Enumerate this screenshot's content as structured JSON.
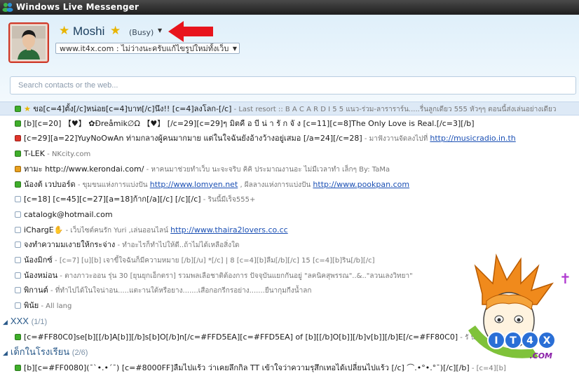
{
  "window": {
    "title": "Windows Live Messenger"
  },
  "profile": {
    "display_name": "Moshi",
    "status": "(Busy)",
    "personal_message": "www.it4x.com : ไม่ว่างนะครับแก้ไขรูปใหม่ทั้งเว็บ"
  },
  "search": {
    "placeholder": "Search contacts or the web..."
  },
  "contacts": [
    {
      "status": "online",
      "star": true,
      "nick": "ขอ[c=4]ตั้ง[/c]หน่อย[c=4]บาท[/c]นึง!!   [c=4]ลงโลก-[/c]",
      "psm": " - Last resort  ::  B A C A R D I    5    5       แนว-ร่วม-ลาราราร์น.....รื่นลูกเดียว   555  หัวๆๆ         ตอนนี้ส่งเล่นอย่างเดียว",
      "link": ""
    },
    {
      "status": "online",
      "nick": "[b][c=20] 【♥】 ✿Đreåmik∅Ω 【♥】 [/c=29][c=29]ๆ มิตคื อ บี น่ า รั ก จั ง [c=11][c=8]The Only Love is Real.[/c=3][/b]",
      "psm": "",
      "link": ""
    },
    {
      "status": "busy",
      "nick": "[c=29][a=22]YuyNoOwAn ท่ามกลางผู้คนมากมาย  แต่ในใจฉันยังอ้างว้างอยู่เสมอ [/a=24][/c=28]",
      "psm": " - มาฟังวานจัดลงไปที่ ",
      "link": "http://musicradio.in.th"
    },
    {
      "status": "online",
      "nick": "T-LEK",
      "psm": " - NKcity.com",
      "link": ""
    },
    {
      "status": "away",
      "nick": "ทามะ http://www.kerondai.com/",
      "psm": " - หาคนมาช่วยทำเว็บ นะจะจริบ คิคิ ประมาณงานอะ ไม่มีเวลาทำ เล็กๆ By: TaMa",
      "link": ""
    },
    {
      "status": "online",
      "nick": "น้องต้ เวปบอร์ด",
      "psm": " - ขุมขนแห่งการแบ่งปัน ",
      "link": "http://www.lomyen.net",
      "psm2": " , ผีลลางแห่งการแบ่งปัน ",
      "link2": "http://www.pookpan.com"
    },
    {
      "status": "offline",
      "nick": "[c=18] [c=45][c=27][a=18]ก้าก[/a][/c] [/c][/c]",
      "psm": " - รินนี้มีเร็จ555+",
      "link": ""
    },
    {
      "status": "offline",
      "nick": "catalogk@hotmail.com",
      "psm": "",
      "link": ""
    },
    {
      "status": "offline",
      "nick": "iChargE",
      "psm": " - เว็บไซต์คนรัก  Yuri  ,เล่นออนไลน์ ",
      "link": "http://www.thaira2lovers.co.cc",
      "emoji": "✋"
    },
    {
      "status": "offline",
      "nick": "จงทำความมเงายให้กระจ่าง",
      "psm": " - ทำอะไรก็ทำไปให้ดี..ถ้าไม่ได้เหลือสิ่งใด",
      "link": ""
    },
    {
      "status": "offline",
      "nick": "น้องมิกซ์",
      "psm": " - [c=7]  [u][b]  เจาขี้ใจฉันก็มีความหมาย   [/b][/u]  *[/c]  |  8 [c=4][b]ลืม[/b][/c] 15 [c=4][b]ริน[/b][/c]",
      "link": ""
    },
    {
      "status": "offline",
      "nick": "น้องหม่อน",
      "psm": " - ตางภาวะออน รุ่น 30 [ยุนยุกเอ็กตรา] รวมพลเลือชาติต้องการ  ปัจจุบันแยกกันอยู่  \"ลคนิคสุพรรณ\"..&..\"ลวนเลงวิทยา\"",
      "link": ""
    },
    {
      "status": "offline",
      "nick": "พิกานต์",
      "psm": " - ที่ทำไปได้ในใจน่าอน.....แตะานใต้หรือยาง.......เสือกอกรีกรอย่าง.......ยืนากุมกีงน้ำลก",
      "link": ""
    },
    {
      "status": "offline",
      "nick": "พิน้ย",
      "psm": " - All lang",
      "link": ""
    }
  ],
  "groups": [
    {
      "name": "XXX",
      "count": "(1/1)"
    },
    {
      "name": "เด็กในโรงเรียน",
      "count": "(2/6)"
    }
  ],
  "group_contacts": [
    {
      "status": "online",
      "nick": "[c=#FF80C0]se[b][[/b]A[b]][/b]s[b]O[/b]n[/c=#FFD5EA][c=#FFD5EA]  of  [b][[/b]O[b]][/b]v[b]][/b]E[/c=#FF80C0]",
      "psm": " - รั น ลิ",
      "link": ""
    },
    {
      "status": "online",
      "nick": "[b][c=#FF0080](¯`•.•´¯) [c=#8000FF]ลืมไปแร้ว ว่าเคยลึกกิล TT เข้าใจว่าความรุสึกเทอได้เปลี่ยนไปแร้ว   [/c]  ⌒.•°•.°¯)[/c][/b]",
      "psm": " - [c=4][b]",
      "link": ""
    }
  ],
  "watermark": {
    "text": "IT4X",
    "sub": ".COM"
  },
  "colors": {
    "online": "#3fae2a",
    "busy": "#e0352b",
    "away": "#e8a020",
    "link": "#1a4fb4",
    "titlebar": "#2b2b2b"
  }
}
